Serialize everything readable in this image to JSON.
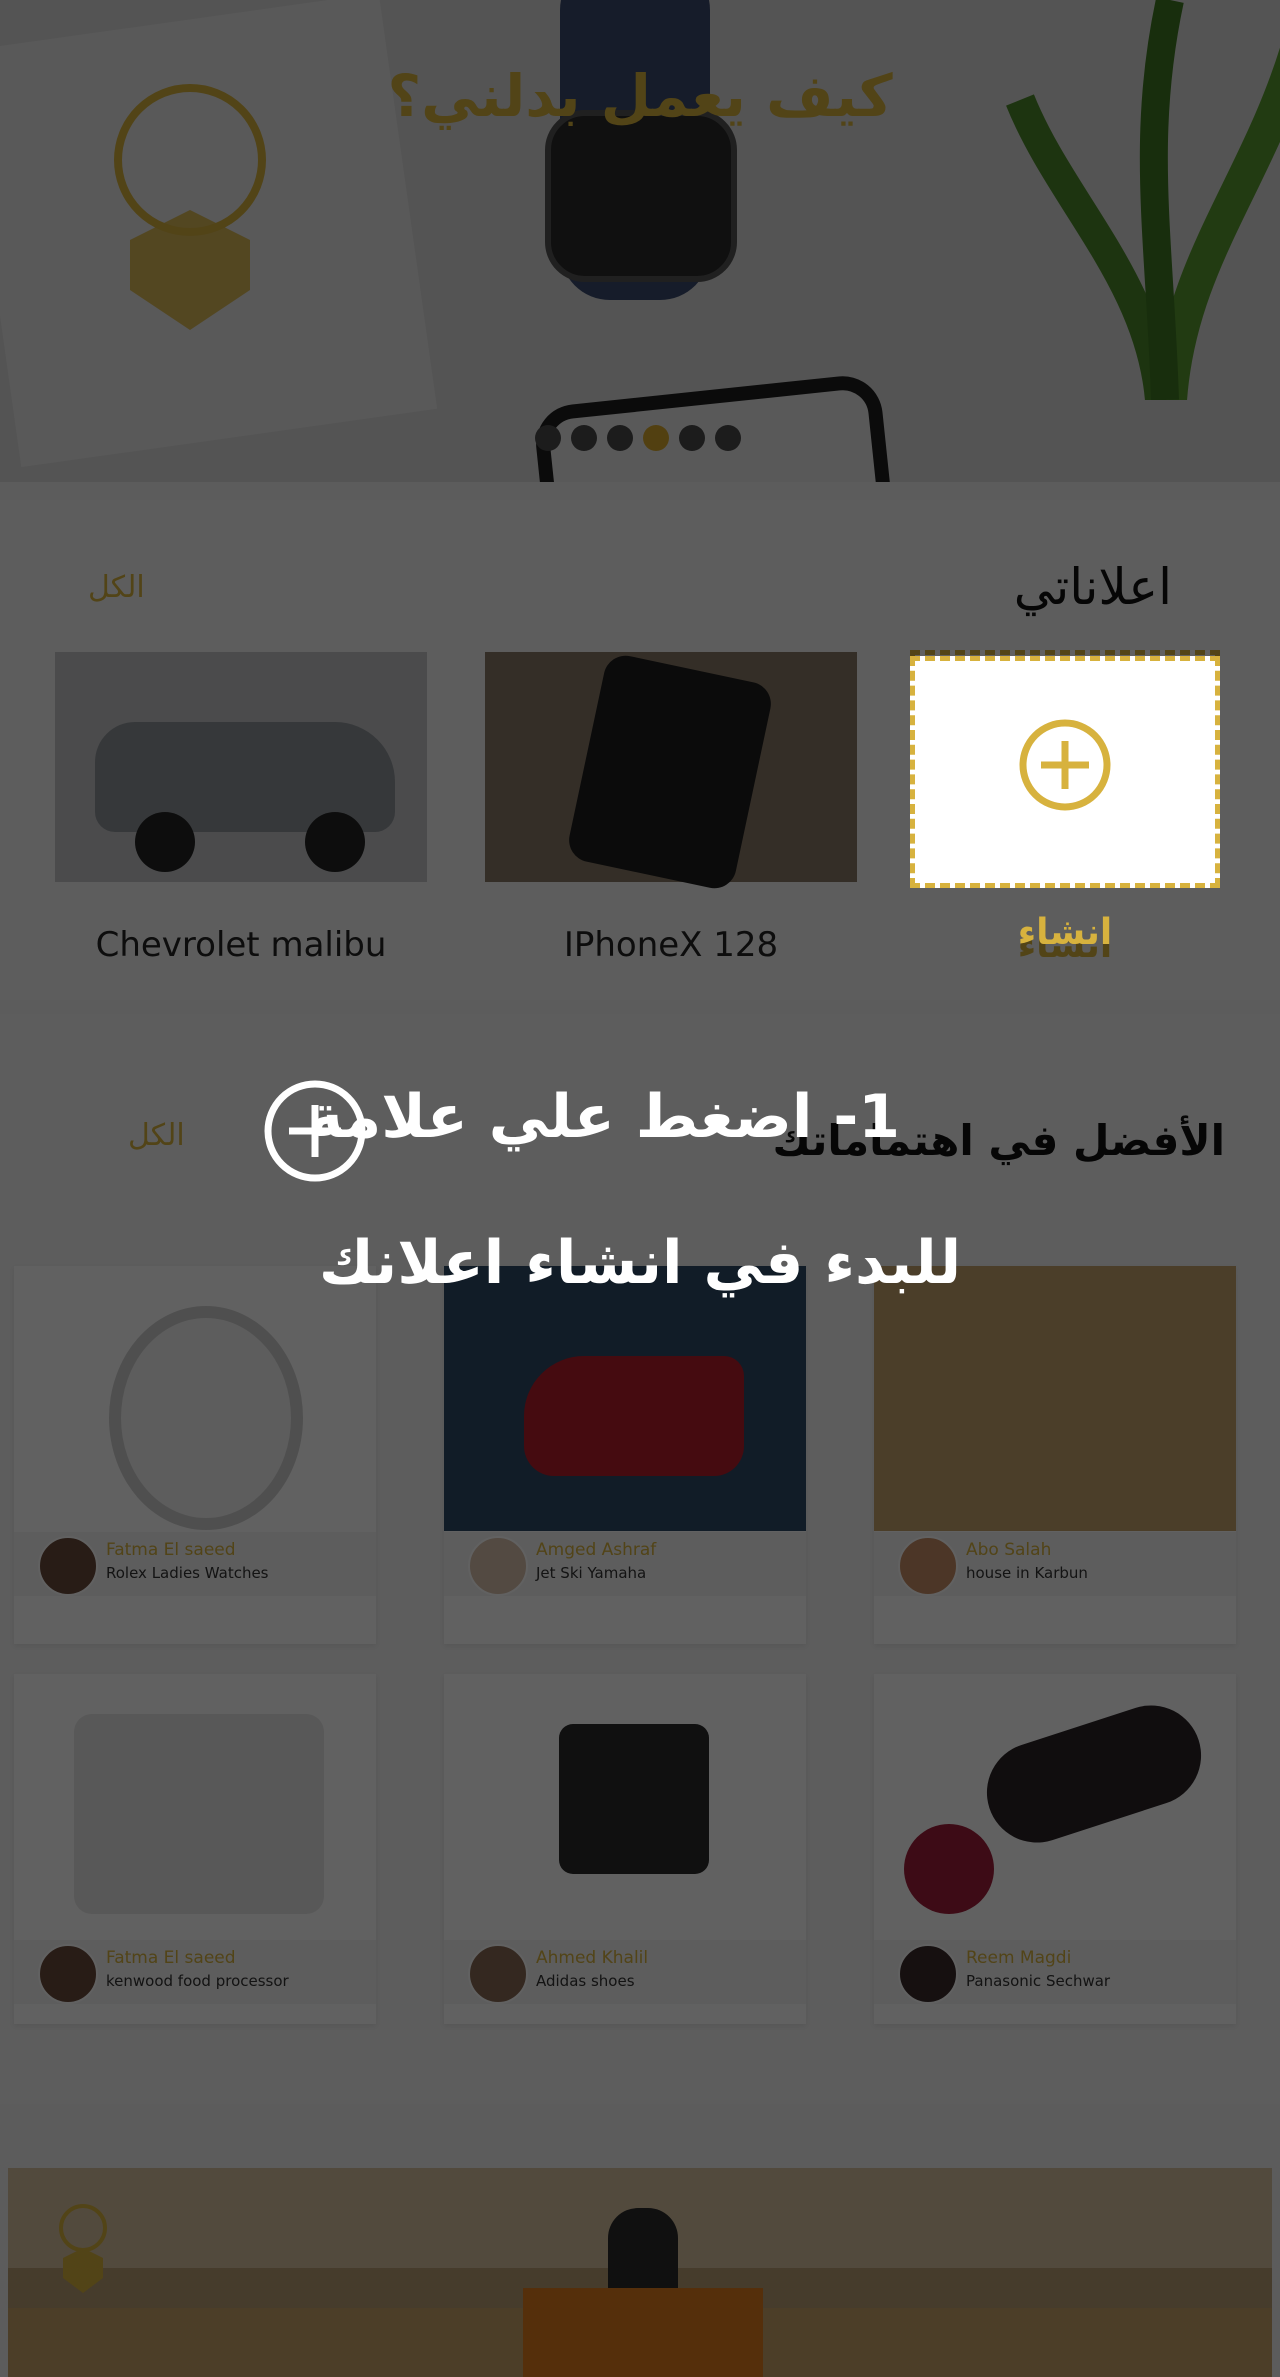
{
  "hero": {
    "title": "كيف يعمل بدلني؟",
    "slides_total": 6,
    "active_slide": 4
  },
  "my_ads": {
    "title": "اعلاناتي",
    "see_all": "الكل",
    "create_label": "انشاء",
    "items": [
      {
        "label": "IPhoneX 128"
      },
      {
        "label": "Chevrolet malibu"
      }
    ]
  },
  "best": {
    "title": "الأفضل في اهتماماتك",
    "see_all": "الكل",
    "cards": [
      {
        "name": "Abo Salah",
        "item": "house in Karbun"
      },
      {
        "name": "Amged Ashraf",
        "item": "Jet Ski Yamaha"
      },
      {
        "name": "Fatma El saeed",
        "item": "Rolex Ladies Watches"
      },
      {
        "name": "Reem Magdi",
        "item": "Panasonic Sechwar"
      },
      {
        "name": "Ahmed Khalil",
        "item": "Adidas shoes"
      },
      {
        "name": "Fatma El saeed",
        "item": "kenwood food processor"
      }
    ]
  },
  "tutorial": {
    "line1": "1- اضغط علي علامة",
    "line2": "للبدء في انشاء اعلانك"
  },
  "colors": {
    "accent": "#d7b23e",
    "overlay": "rgba(0,0,0,0.62)"
  }
}
